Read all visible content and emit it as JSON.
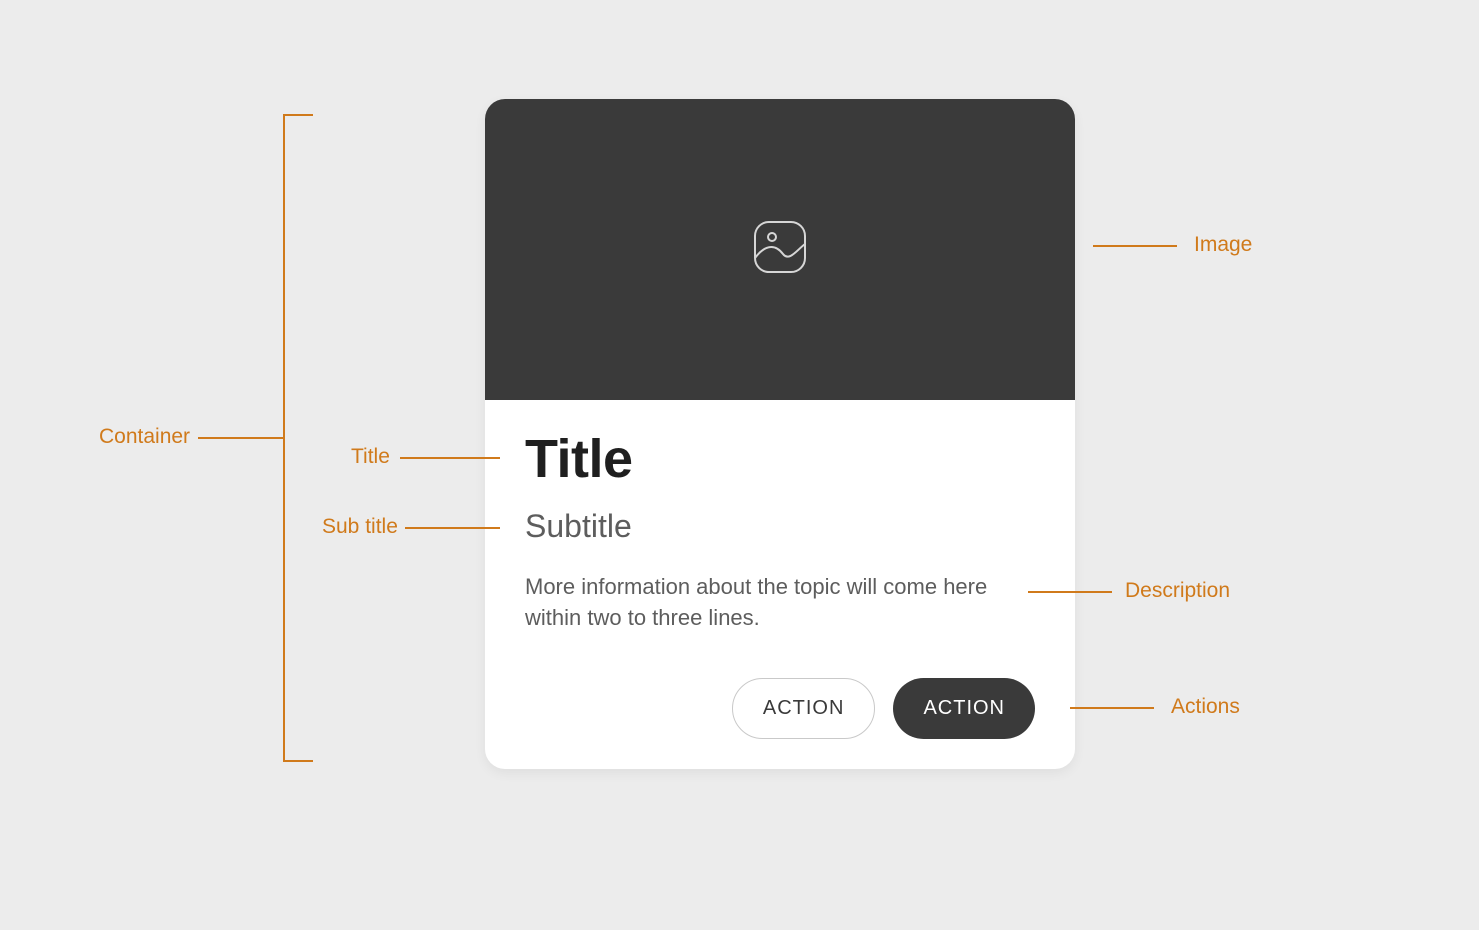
{
  "card": {
    "title": "Title",
    "subtitle": "Subtitle",
    "description": "More information about the topic will come here within two to three lines.",
    "action_secondary": "ACTION",
    "action_primary": "ACTION"
  },
  "annotations": {
    "container": "Container",
    "title": "Title",
    "subtitle": "Sub title",
    "image": "Image",
    "description": "Description",
    "actions": "Actions"
  }
}
